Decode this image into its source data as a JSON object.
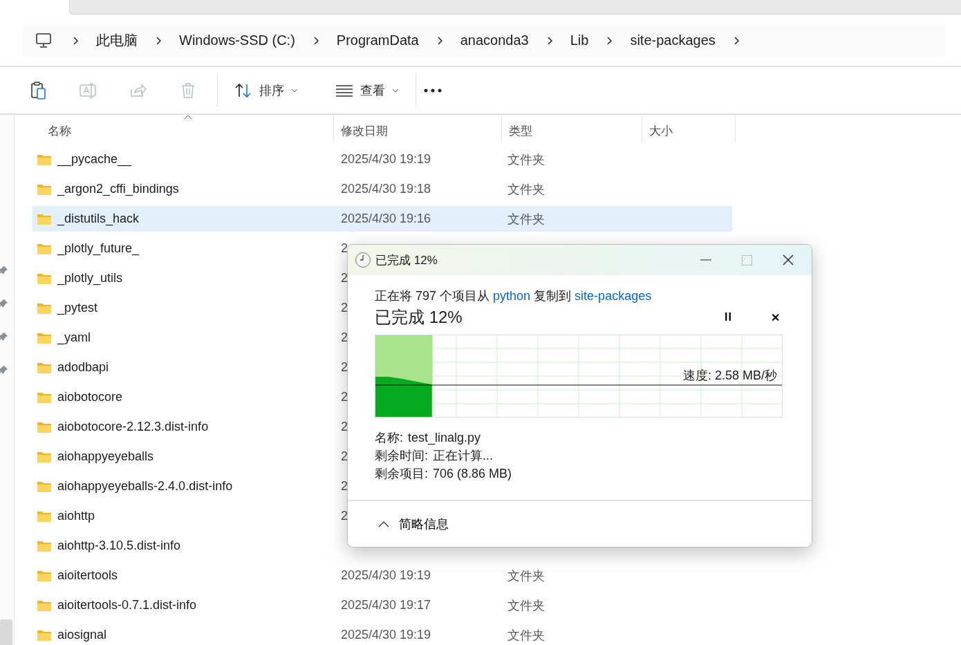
{
  "breadcrumb": [
    "此电脑",
    "Windows-SSD (C:)",
    "ProgramData",
    "anaconda3",
    "Lib",
    "site-packages"
  ],
  "toolbar": {
    "actions": [
      {
        "kind": "paste",
        "disabled": false
      },
      {
        "kind": "rename",
        "disabled": true
      },
      {
        "kind": "share",
        "disabled": true
      },
      {
        "kind": "delete",
        "disabled": true
      }
    ],
    "sort": "排序",
    "view": "查看"
  },
  "columns": [
    "名称",
    "修改日期",
    "类型",
    "大小"
  ],
  "rows": [
    {
      "name": "__pycache__",
      "date": "2025/4/30 19:19",
      "type": "文件夹",
      "selected": false
    },
    {
      "name": "_argon2_cffi_bindings",
      "date": "2025/4/30 19:18",
      "type": "文件夹",
      "selected": false
    },
    {
      "name": "_distutils_hack",
      "date": "2025/4/30 19:16",
      "type": "文件夹",
      "selected": true
    },
    {
      "name": "_plotly_future_",
      "date": "2",
      "selected": false
    },
    {
      "name": "_plotly_utils",
      "date": "2",
      "selected": false
    },
    {
      "name": "_pytest",
      "date": "2",
      "selected": false
    },
    {
      "name": "_yaml",
      "date": "2",
      "selected": false
    },
    {
      "name": "adodbapi",
      "date": "2",
      "selected": false
    },
    {
      "name": "aiobotocore",
      "date": "2",
      "selected": false
    },
    {
      "name": "aiobotocore-2.12.3.dist-info",
      "date": "2",
      "selected": false
    },
    {
      "name": "aiohappyeyeballs",
      "date": "2",
      "selected": false
    },
    {
      "name": "aiohappyeyeballs-2.4.0.dist-info",
      "date": "2",
      "selected": false
    },
    {
      "name": "aiohttp",
      "date": "2",
      "selected": false
    },
    {
      "name": "aiohttp-3.10.5.dist-info",
      "selected": false
    },
    {
      "name": "aioitertools",
      "date": "2025/4/30 19:19",
      "type": "文件夹",
      "selected": false
    },
    {
      "name": "aioitertools-0.7.1.dist-info",
      "date": "2025/4/30 19:17",
      "type": "文件夹",
      "selected": false
    },
    {
      "name": "aiosignal",
      "date": "2025/4/30 19:19",
      "type": "文件夹",
      "selected": false
    }
  ],
  "dialog": {
    "title": "已完成 12%",
    "copy_prefix": "正在将 797 个项目从",
    "source": "python",
    "copy_middle": "复制到",
    "target": "site-packages",
    "heading": "已完成 12%",
    "pause": "II",
    "cancel": "✕",
    "level": 0.14,
    "speed": "速度: 2.58 MB/秒",
    "details": [
      {
        "label": "名称:",
        "value": "test_linalg.py"
      },
      {
        "label": "剩余时间:",
        "value": "正在计算..."
      },
      {
        "label": "剩余项目:",
        "value": "706 (8.86 MB)"
      }
    ],
    "less_details": "简略信息"
  }
}
